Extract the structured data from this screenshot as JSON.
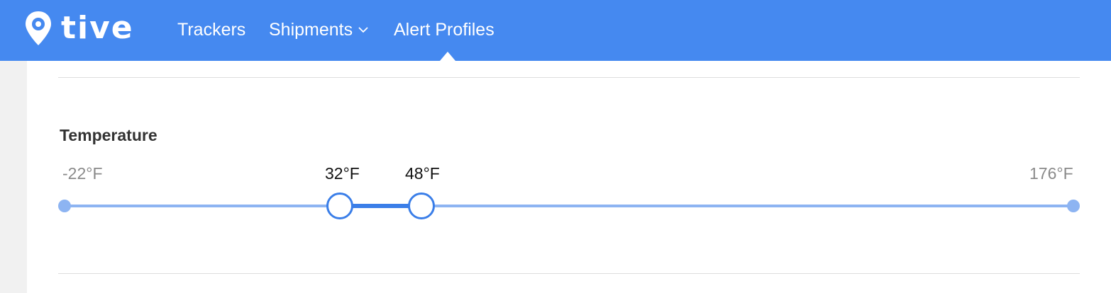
{
  "brand": {
    "logo_text": "tive",
    "logo_icon": "location-pin-icon",
    "nav_color": "#4589f0"
  },
  "nav": {
    "items": [
      {
        "label": "Trackers"
      },
      {
        "label": "Shipments",
        "icon": "chevron-down-icon"
      },
      {
        "label": "Alert Profiles",
        "active": true
      }
    ]
  },
  "temperature": {
    "title": "Temperature",
    "min_label": "-22°F",
    "max_label": "176°F",
    "low_label": "32°F",
    "high_label": "48°F",
    "min_value": -22,
    "max_value": 176,
    "low_value": 32,
    "high_value": 48,
    "accent_color": "#3a7ee8",
    "track_color": "#8db4f2"
  }
}
